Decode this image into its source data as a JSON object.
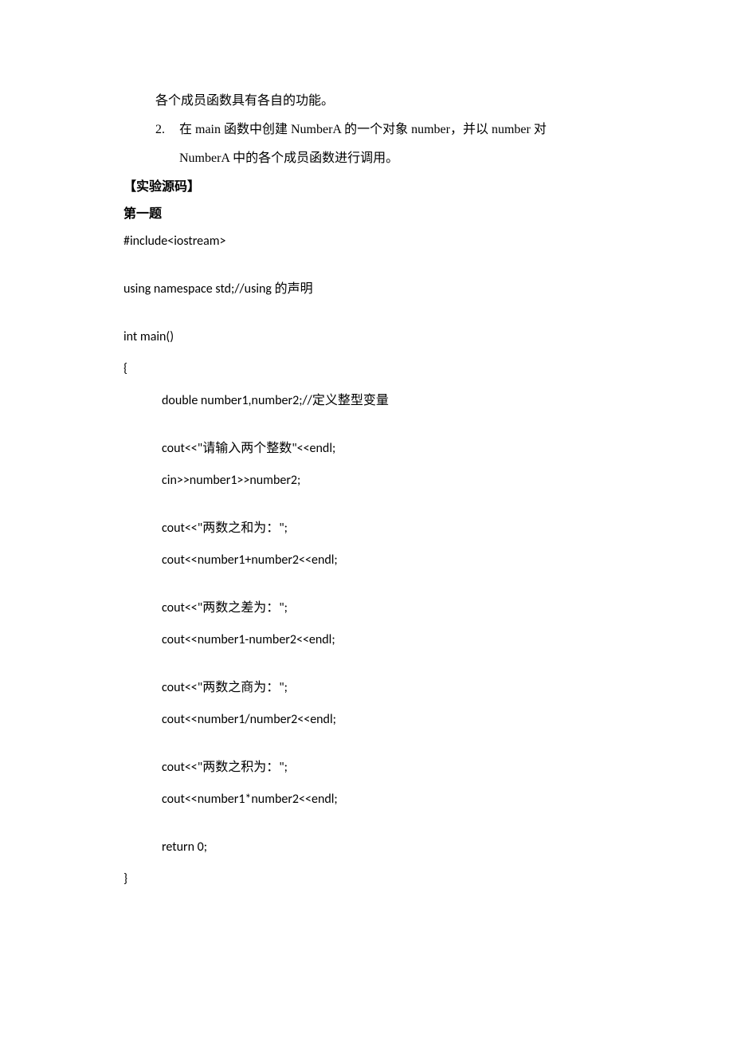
{
  "list": {
    "cont1": "各个成员函数具有各自的功能。",
    "item2_num": "2.",
    "item2_line1": "在 main 函数中创建 NumberA 的一个对象 number，并以 number 对",
    "item2_line2": "NumberA 中的各个成员函数进行调用。"
  },
  "headings": {
    "src": "【实验源码】",
    "q1": "第一题"
  },
  "code": {
    "l1": "#include<iostream>",
    "l2a": "using namespace std;//using ",
    "l2b": "的声明",
    "l3": "int main()",
    "l4": "{",
    "l5a": "double number1,number2;//",
    "l5b": "定义整型变量",
    "l6a": "cout<<\"",
    "l6b": "请输入两个整数",
    "l6c": "\"<<endl;",
    "l7": "cin>>number1>>number2;",
    "l8a": "cout<<\"",
    "l8b": "两数之和为：",
    "l8c": "\";",
    "l9": "cout<<number1+number2<<endl;",
    "l10a": "cout<<\"",
    "l10b": "两数之差为：",
    "l10c": "\";",
    "l11": "cout<<number1-number2<<endl;",
    "l12a": "cout<<\"",
    "l12b": "两数之商为：",
    "l12c": "\";",
    "l13": "cout<<number1/number2<<endl;",
    "l14a": "cout<<\"",
    "l14b": "两数之积为：",
    "l14c": "\";",
    "l15": "cout<<number1*number2<<endl;",
    "l16": "return 0;",
    "l17": "}"
  }
}
